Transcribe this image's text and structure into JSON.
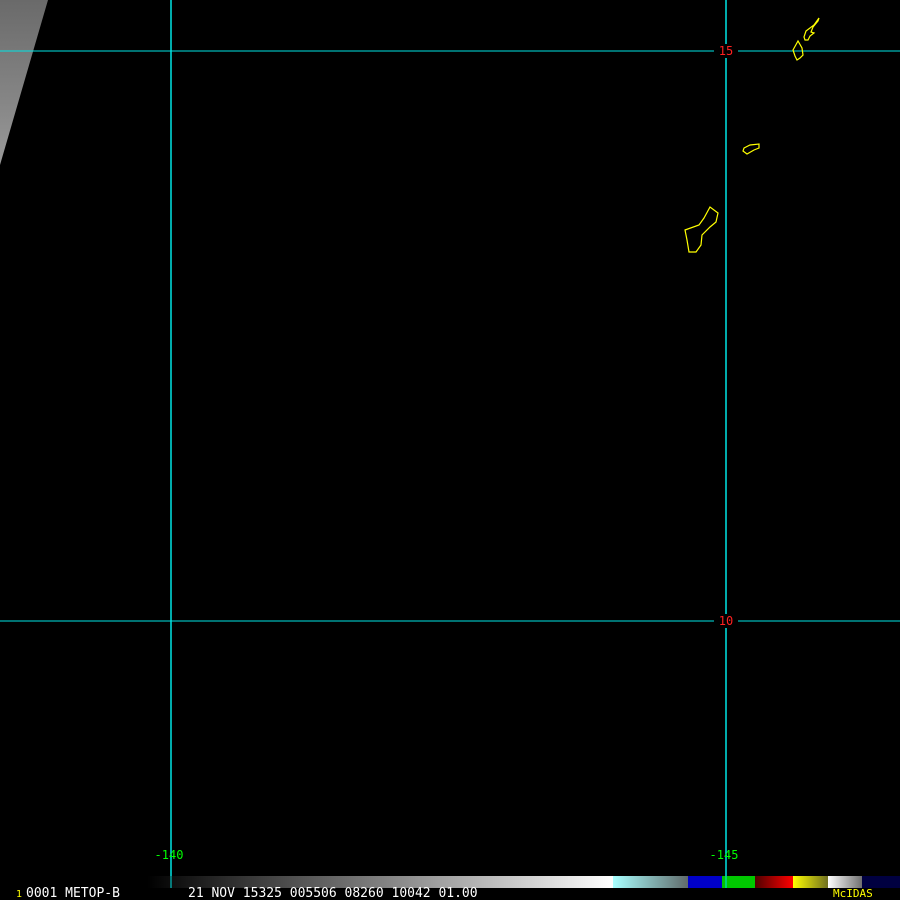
{
  "image": {
    "satellite": "METOP-B",
    "frame_number": "1",
    "info_line": "0001 METOP-B",
    "date_time_line": "21 NOV 15325 005506 08260 10042 01.00",
    "brand": "McIDAS"
  },
  "grid": {
    "latitude_labels": [
      "15",
      "10"
    ],
    "longitude_labels": [
      "-140",
      "-145"
    ],
    "grid_color": "#00e5e5",
    "lat_label_color": "#ff2020",
    "lon_label_color": "#00ff00"
  },
  "coastline_color": "#ffff00",
  "colorbar": {
    "segments": [
      "#000000-#ffffff",
      "#a0ffff-#606060",
      "#0000c0",
      "#00c000",
      "#600000-#ff0000",
      "#ffff00-#808020",
      "#ffffff-#808080",
      "#000040"
    ]
  }
}
